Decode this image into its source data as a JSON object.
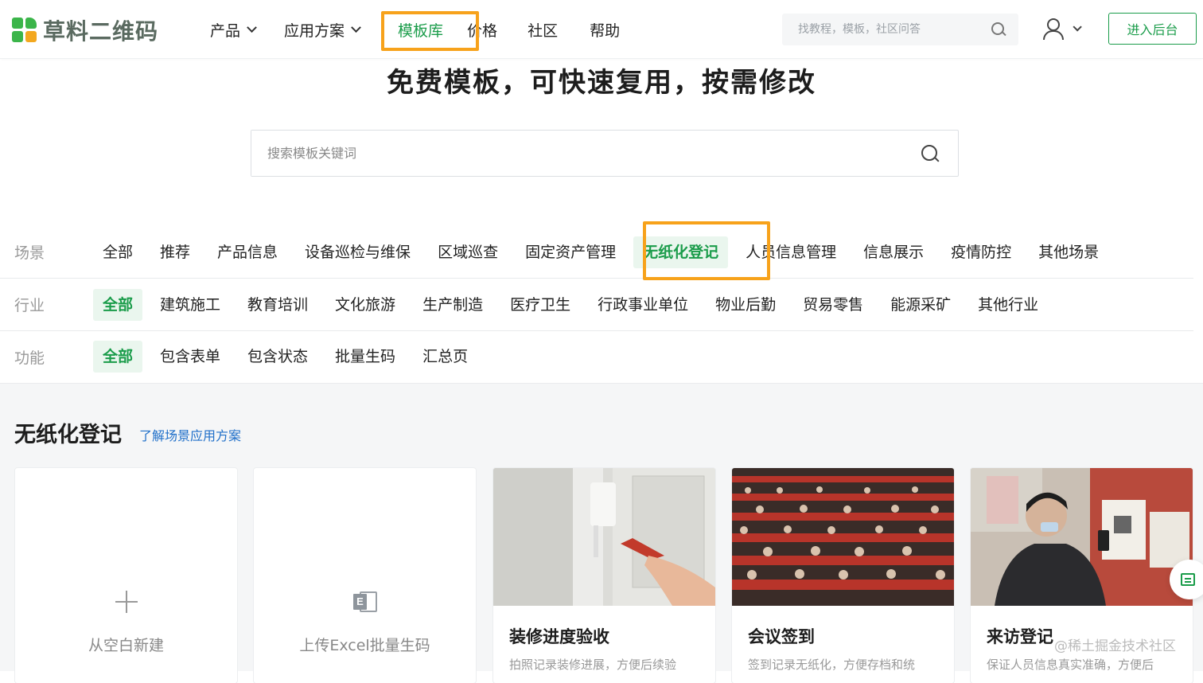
{
  "header": {
    "logo_text": "草料二维码",
    "nav": [
      {
        "label": "产品",
        "has_dropdown": true
      },
      {
        "label": "应用方案",
        "has_dropdown": true
      },
      {
        "label": "模板库",
        "has_dropdown": false,
        "active": true
      },
      {
        "label": "价格",
        "has_dropdown": false
      },
      {
        "label": "社区",
        "has_dropdown": false
      },
      {
        "label": "帮助",
        "has_dropdown": false
      }
    ],
    "search_placeholder": "找教程，模板，社区问答",
    "enter_button": "进入后台"
  },
  "hero": {
    "title": "免费模板，可快速复用，按需修改",
    "search_placeholder": "搜索模板关键词"
  },
  "filters": {
    "scene": {
      "label": "场景",
      "items": [
        "全部",
        "推荐",
        "产品信息",
        "设备巡检与维保",
        "区域巡查",
        "固定资产管理",
        "无纸化登记",
        "人员信息管理",
        "信息展示",
        "疫情防控",
        "其他场景"
      ],
      "selected": "无纸化登记"
    },
    "industry": {
      "label": "行业",
      "items": [
        "全部",
        "建筑施工",
        "教育培训",
        "文化旅游",
        "生产制造",
        "医疗卫生",
        "行政事业单位",
        "物业后勤",
        "贸易零售",
        "能源采矿",
        "其他行业"
      ],
      "selected": "全部"
    },
    "feature": {
      "label": "功能",
      "items": [
        "全部",
        "包含表单",
        "包含状态",
        "批量生码",
        "汇总页"
      ],
      "selected": "全部"
    }
  },
  "section": {
    "title": "无纸化登记",
    "link": "了解场景应用方案",
    "blank_card": "从空白新建",
    "excel_card": "上传Excel批量生码",
    "templates": [
      {
        "title": "装修进度验收",
        "desc": "拍照记录装修进展，方便后续验"
      },
      {
        "title": "会议签到",
        "desc": "签到记录无纸化，方便存档和统"
      },
      {
        "title": "来访登记",
        "desc": "保证人员信息真实准确，方便后"
      }
    ]
  },
  "watermark": "@稀土掘金技术社区",
  "colors": {
    "brand": "#1a9c4a",
    "highlight": "#f7a21b",
    "link": "#1f6fc9"
  }
}
